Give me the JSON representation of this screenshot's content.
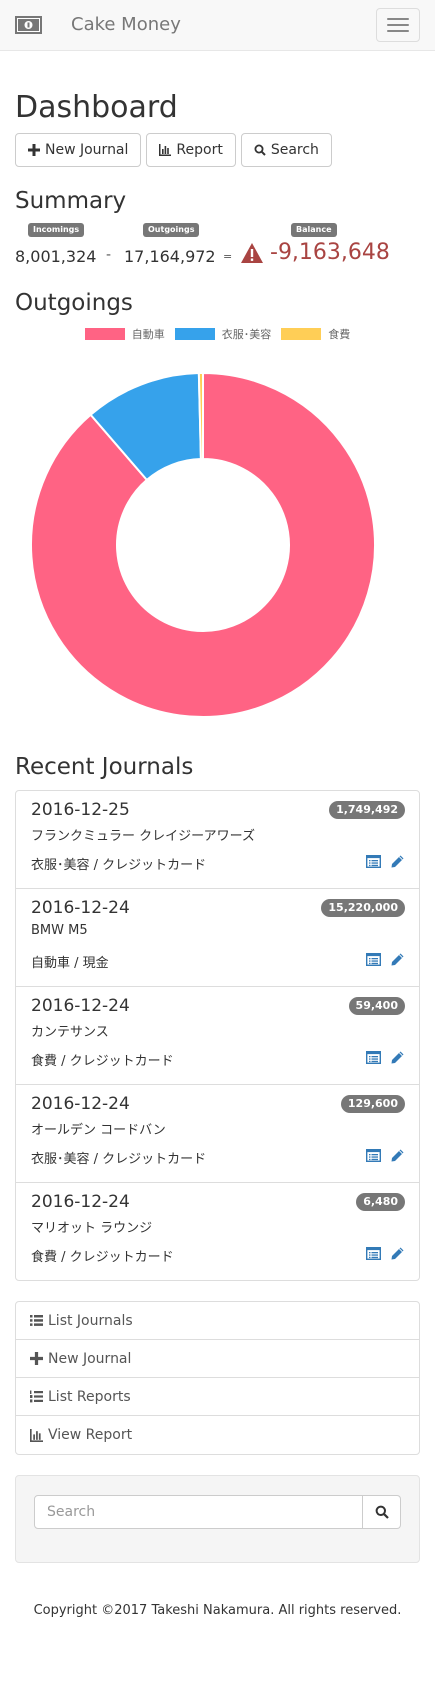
{
  "navbar": {
    "brand": "Cake Money",
    "brand_icon": "banknote-icon",
    "toggle_icon": "hamburger-icon"
  },
  "page": {
    "title": "Dashboard"
  },
  "toolbar": {
    "new_journal": "New Journal",
    "report": "Report",
    "search": "Search"
  },
  "summary": {
    "title": "Summary",
    "incomings_label": "Incomings",
    "incomings": "8,001,324",
    "minus": "-",
    "outgoings_label": "Outgoings",
    "outgoings": "17,164,972",
    "equals": "=",
    "balance_label": "Balance",
    "balance": "-9,163,648"
  },
  "outgoings": {
    "title": "Outgoings"
  },
  "chart_data": {
    "type": "pie",
    "categories": [
      "自動車",
      "衣服･美容",
      "食費"
    ],
    "values": [
      15220000,
      1879092,
      65880
    ],
    "colors": [
      "#ff6384",
      "#36a2eb",
      "#ffce56"
    ],
    "legend_position": "top"
  },
  "recent": {
    "title": "Recent Journals",
    "items": [
      {
        "date": "2016-12-25",
        "amount": "1,749,492",
        "name": "フランクミュラー クレイジーアワーズ",
        "category": "衣服･美容 / クレジットカード"
      },
      {
        "date": "2016-12-24",
        "amount": "15,220,000",
        "name": "BMW M5",
        "category": "自動車 / 現金"
      },
      {
        "date": "2016-12-24",
        "amount": "59,400",
        "name": "カンテサンス",
        "category": "食費 / クレジットカード"
      },
      {
        "date": "2016-12-24",
        "amount": "129,600",
        "name": "オールデン コードバン",
        "category": "衣服･美容 / クレジットカード"
      },
      {
        "date": "2016-12-24",
        "amount": "6,480",
        "name": "マリオット ラウンジ",
        "category": "食費 / クレジットカード"
      }
    ]
  },
  "nav": {
    "list_journals": "List Journals",
    "new_journal": "New Journal",
    "list_reports": "List Reports",
    "view_report": "View Report"
  },
  "search_form": {
    "placeholder": "Search"
  },
  "footer": {
    "copyright": "Copyright ©2017 Takeshi Nakamura. All rights reserved."
  },
  "colors": {
    "link": "#337ab7",
    "danger": "#a94442",
    "badge": "#777777"
  }
}
